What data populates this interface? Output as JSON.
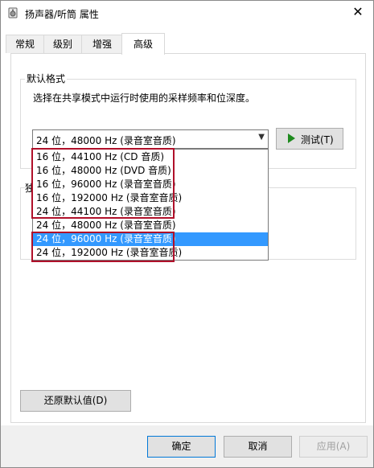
{
  "window": {
    "title": "扬声器/听筒 属性"
  },
  "tabs": [
    {
      "label": "常规"
    },
    {
      "label": "级别"
    },
    {
      "label": "增强"
    },
    {
      "label": "高级"
    }
  ],
  "default_format": {
    "group_label": "默认格式",
    "description": "选择在共享模式中运行时使用的采样频率和位深度。",
    "selected_value": "24 位，48000 Hz (录音室音质)",
    "test_button": "测试(T)",
    "options": [
      "16 位，44100 Hz (CD 音质)",
      "16 位，48000 Hz (DVD 音质)",
      "16 位，96000 Hz (录音室音质)",
      "16 位，192000 Hz (录音室音质)",
      "24 位，44100 Hz (录音室音质)",
      "24 位，48000 Hz (录音室音质)",
      "24 位，96000 Hz (录音室音质)",
      "24 位，192000 Hz (录音室音质)"
    ]
  },
  "exclusive": {
    "partial_label": "独"
  },
  "restore_button": "还原默认值(D)",
  "footer": {
    "ok": "确定",
    "cancel": "取消",
    "apply": "应用(A)"
  },
  "colors": {
    "highlight_box": "#b0102a",
    "selected_row": "#3399ff"
  }
}
